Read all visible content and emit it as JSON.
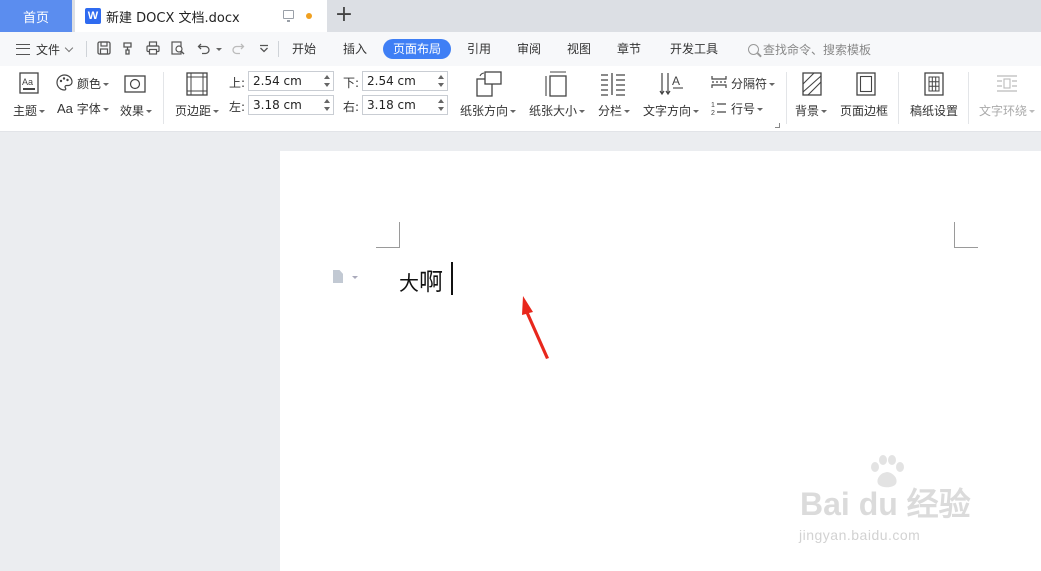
{
  "titlebar": {
    "home_tab": "首页",
    "doc_tab_title": "新建 DOCX 文档.docx",
    "doc_icon_letter": "W",
    "new_tab_symbol": "+",
    "unsaved_color": "#f0a020"
  },
  "menubar": {
    "file_label": "文件",
    "tabs": [
      "开始",
      "插入",
      "页面布局",
      "引用",
      "审阅",
      "视图",
      "章节",
      "开发工具"
    ],
    "active_tab": "页面布局",
    "search_placeholder": "查找命令、搜索模板",
    "accent": "#3f7ff5"
  },
  "ribbon": {
    "theme": "主题",
    "colors": "颜色",
    "fonts": "字体",
    "fonts_prefix": "Aa",
    "effects": "效果",
    "margins": "页边距",
    "margin_top_label": "上:",
    "margin_top": "2.54 cm",
    "margin_bottom_label": "下:",
    "margin_bottom": "2.54 cm",
    "margin_left_label": "左:",
    "margin_left": "3.18 cm",
    "margin_right_label": "右:",
    "margin_right": "3.18 cm",
    "orientation": "纸张方向",
    "paper_size": "纸张大小",
    "columns": "分栏",
    "text_direction": "文字方向",
    "breaks": "分隔符",
    "line_numbers": "行号",
    "background": "背景",
    "page_borders": "页面边框",
    "manuscript": "稿纸设置",
    "text_wrap": "文字环绕"
  },
  "document": {
    "char1": "大",
    "char2": "啊"
  },
  "watermark": {
    "brand": "Bai du 经验",
    "url": "jingyan.baidu.com"
  }
}
